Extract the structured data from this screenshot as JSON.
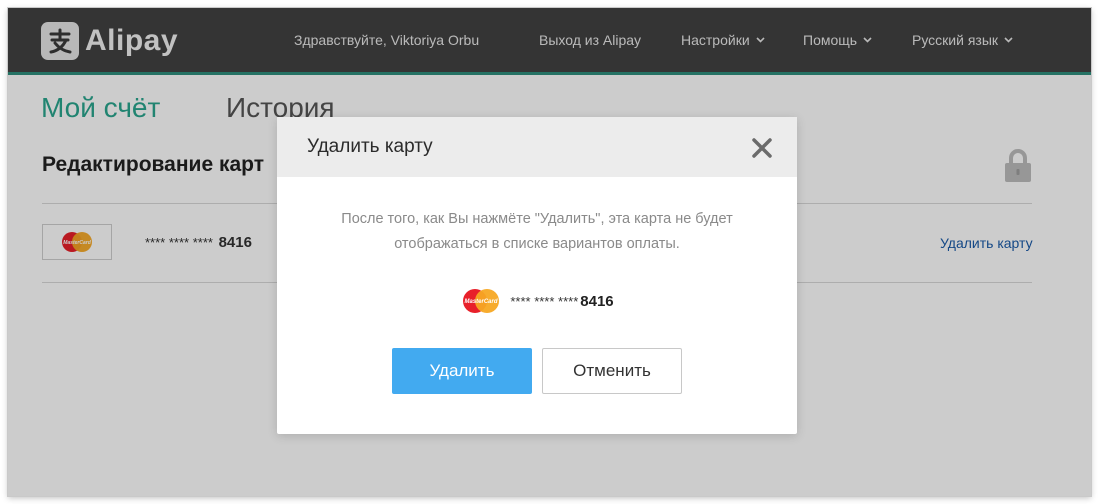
{
  "header": {
    "logo_text": "Alipay",
    "greeting": "Здравствуйте, Viktoriya Orbu",
    "logout": "Выход из Alipay",
    "settings": "Настройки",
    "help": "Помощь",
    "language": "Русский язык"
  },
  "tabs": {
    "account": "Мой счёт",
    "history": "История"
  },
  "section": {
    "title": "Редактирование карт"
  },
  "card_row": {
    "masked_prefix": "**** **** ****",
    "last4": "8416",
    "remove_link": "Удалить карту",
    "card_brand_text": "MasterCard"
  },
  "modal": {
    "title": "Удалить карту",
    "message_line1": "После того, как Вы нажмёте \"Удалить\", эта карта не будет",
    "message_line2": "отображаться в списке вариантов оплаты.",
    "masked_prefix": "**** **** ****",
    "last4": "8416",
    "delete_label": "Удалить",
    "cancel_label": "Отменить"
  },
  "colors": {
    "header_bg": "#424242",
    "accent_teal": "#2aa58e",
    "primary_button": "#42aaf0",
    "link_blue": "#1a5aa8"
  },
  "icons": [
    "alipay-logo-icon",
    "chevron-down-icon",
    "lock-icon",
    "mastercard-icon",
    "close-icon"
  ]
}
